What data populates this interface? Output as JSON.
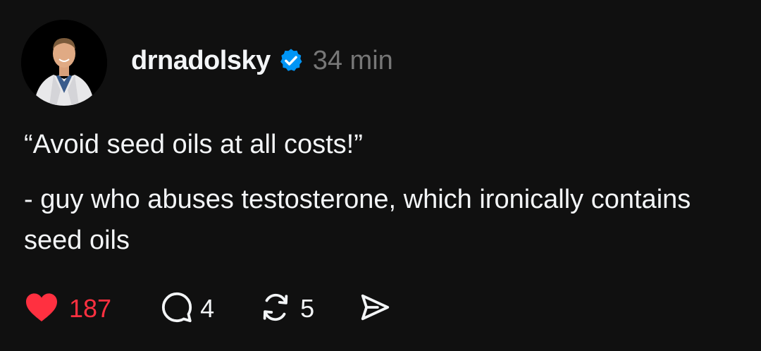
{
  "post": {
    "username": "drnadolsky",
    "timestamp": "34 min",
    "verified": true,
    "paragraphs": [
      "“Avoid seed oils at all costs!”",
      "- guy who abuses testosterone, which ironically contains seed oils"
    ],
    "actions": {
      "likes": "187",
      "replies": "4",
      "reposts": "5"
    }
  },
  "icons": {
    "verified": "verified-badge-icon",
    "like": "heart-icon",
    "reply": "speech-bubble-icon",
    "repost": "repost-arrows-icon",
    "share": "paper-plane-icon"
  },
  "colors": {
    "background": "#101010",
    "text": "#f3f5f7",
    "muted": "#777777",
    "like_active": "#ff3040",
    "verified": "#0095f6"
  }
}
